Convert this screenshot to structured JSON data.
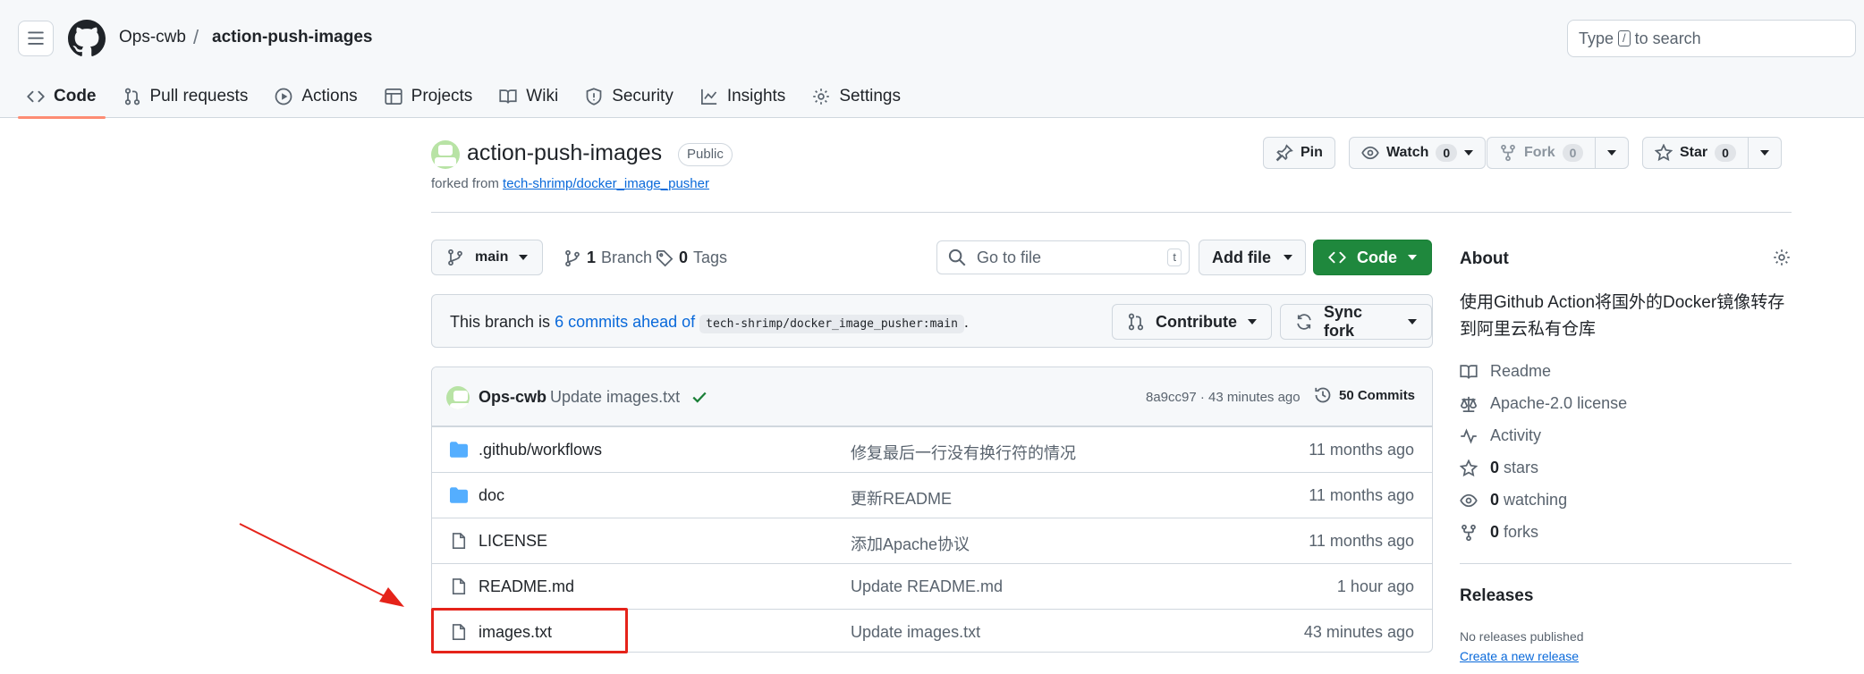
{
  "header": {
    "owner": "Ops-cwb",
    "separator": "/",
    "repo": "action-push-images",
    "search_prefix": "Type",
    "search_key": "/",
    "search_suffix": "to search"
  },
  "tabs": [
    {
      "label": "Code",
      "icon": "code-icon",
      "active": true
    },
    {
      "label": "Pull requests",
      "icon": "git-pull-request-icon"
    },
    {
      "label": "Actions",
      "icon": "play-icon"
    },
    {
      "label": "Projects",
      "icon": "table-icon"
    },
    {
      "label": "Wiki",
      "icon": "book-icon"
    },
    {
      "label": "Security",
      "icon": "shield-icon"
    },
    {
      "label": "Insights",
      "icon": "graph-icon"
    },
    {
      "label": "Settings",
      "icon": "gear-icon"
    }
  ],
  "repo": {
    "title": "action-push-images",
    "visibility": "Public",
    "forked_prefix": "forked from",
    "forked_source": "tech-shrimp/docker_image_pusher"
  },
  "actions": {
    "pin": "Pin",
    "watch": "Watch",
    "watch_count": "0",
    "fork": "Fork",
    "fork_count": "0",
    "star": "Star",
    "star_count": "0"
  },
  "toolbar": {
    "branch": "main",
    "branch_count": "1",
    "branch_label": "Branch",
    "tag_count": "0",
    "tag_label": "Tags",
    "go_to_file": "Go to file",
    "go_to_file_key": "t",
    "add_file": "Add file",
    "code": "Code"
  },
  "ahead": {
    "prefix": "This branch is",
    "link": "6 commits ahead of",
    "ref": "tech-shrimp/docker_image_pusher:main",
    "suffix": ".",
    "contribute": "Contribute",
    "sync": "Sync fork"
  },
  "commit": {
    "author": "Ops-cwb",
    "message": "Update images.txt",
    "meta": "8a9cc97 · 43 minutes ago",
    "commits": "50 Commits"
  },
  "files": [
    {
      "type": "folder",
      "name": ".github/workflows",
      "message": "修复最后一行没有换行符的情况",
      "date": "11 months ago"
    },
    {
      "type": "folder",
      "name": "doc",
      "message": "更新README",
      "date": "11 months ago"
    },
    {
      "type": "file",
      "name": "LICENSE",
      "message": "添加Apache协议",
      "date": "11 months ago"
    },
    {
      "type": "file",
      "name": "README.md",
      "message": "Update README.md",
      "date": "1 hour ago"
    },
    {
      "type": "file",
      "name": "images.txt",
      "message": "Update images.txt",
      "date": "43 minutes ago"
    }
  ],
  "about": {
    "heading": "About",
    "description": "使用Github Action将国外的Docker镜像转存到阿里云私有仓库",
    "readme": "Readme",
    "license": "Apache-2.0 license",
    "activity": "Activity",
    "stars_count": "0",
    "stars_label": "stars",
    "watching_count": "0",
    "watching_label": "watching",
    "forks_count": "0",
    "forks_label": "forks"
  },
  "releases": {
    "heading": "Releases",
    "none": "No releases published",
    "create": "Create a new release"
  },
  "colors": {
    "accent_underline": "#fd8c73",
    "code_button": "#1f883d",
    "link": "#0969da",
    "annotation": "#e5231a",
    "folder": "#54aeff"
  }
}
